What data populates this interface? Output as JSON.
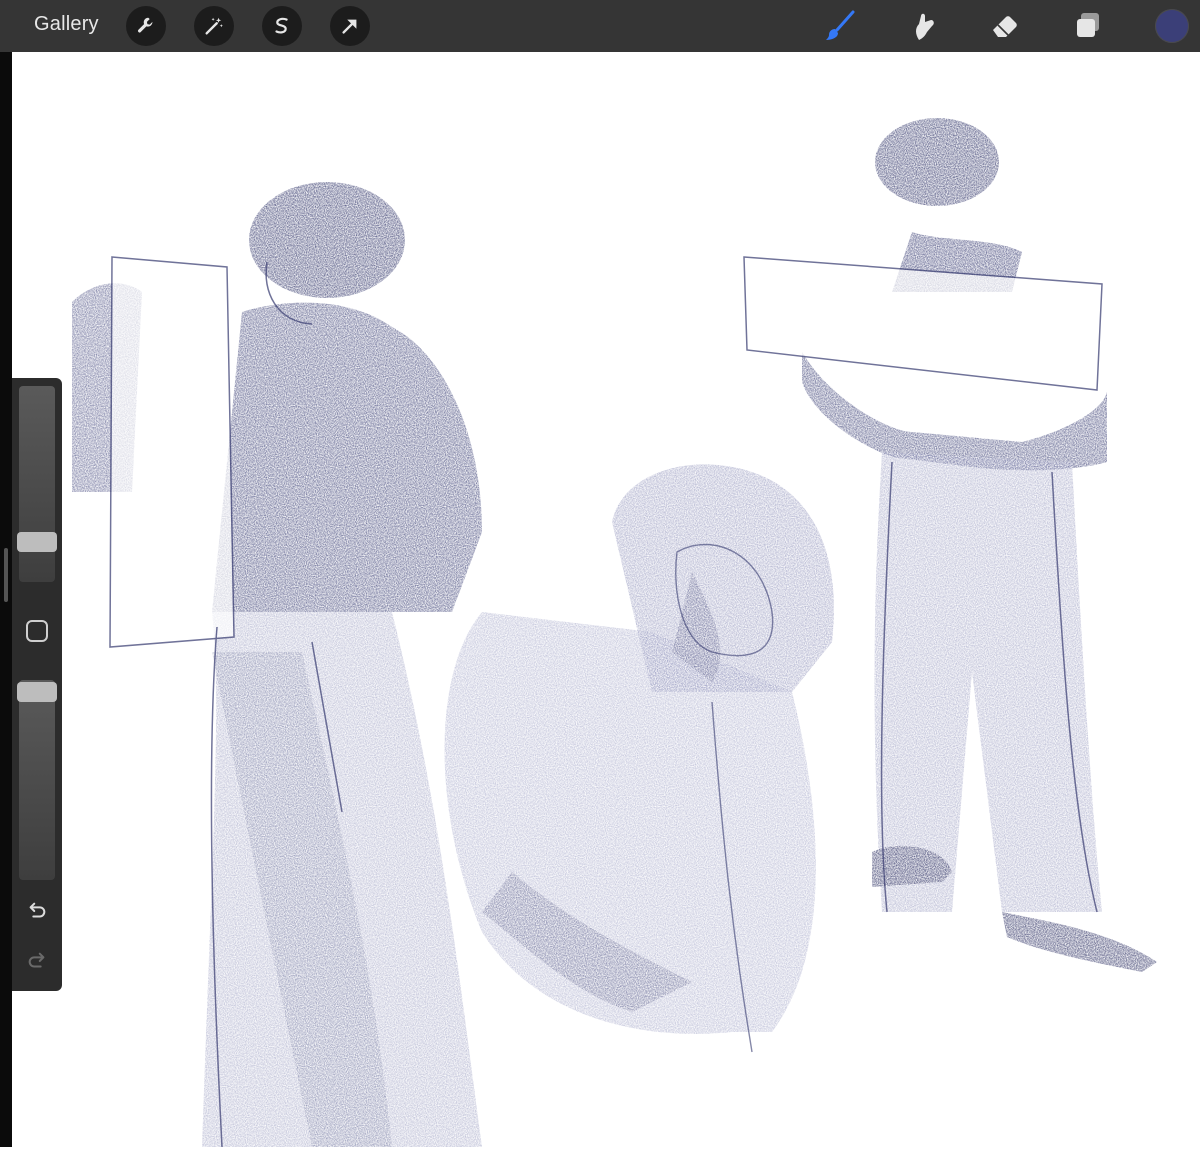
{
  "topbar": {
    "gallery_label": "Gallery",
    "left_tools": [
      "wrench-icon",
      "magic-wand-icon",
      "selection-icon",
      "transform-arrow-icon"
    ],
    "right_tools": [
      "brush-icon",
      "smudge-icon",
      "eraser-icon",
      "layers-icon"
    ],
    "active_tool": "brush-icon",
    "current_color": "#3b3f78"
  },
  "sidebar": {
    "brush_size_slider": "slider",
    "opacity_slider": "slider",
    "modify_button": "square-button",
    "undo": "undo-icon",
    "redo": "redo-icon"
  },
  "colors": {
    "accent_blue": "#3478f6",
    "ink": "#34386e"
  }
}
